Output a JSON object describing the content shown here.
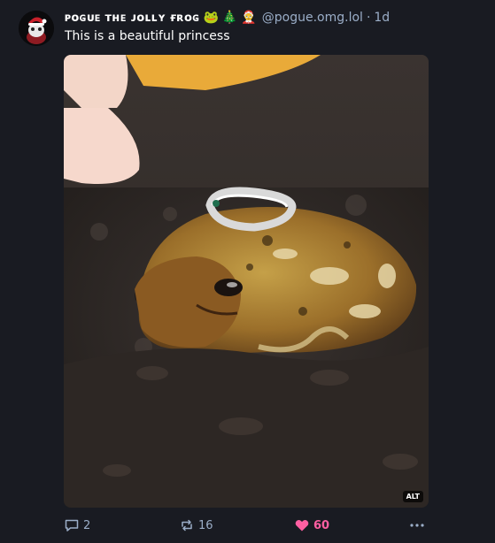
{
  "post": {
    "author": {
      "display_name": "ᴘᴏɢᴜᴇ ᴛʜᴇ ᴊᴏʟʟʏ ғʀᴏɢ",
      "emojis": [
        "🐸",
        "🎄",
        "🤶"
      ],
      "handle": "@pogue.omg.lol",
      "avatar_icon": "pogue-avatar"
    },
    "separator": "·",
    "time": "1d",
    "text": "This is a beautiful princess",
    "media": {
      "alt_badge": "ALT"
    },
    "actions": {
      "reply_count": "2",
      "boost_count": "16",
      "favorite_count": "60"
    }
  },
  "colors": {
    "background": "#191b22",
    "muted": "#9baec8",
    "favorite": "#ff5fa2"
  }
}
